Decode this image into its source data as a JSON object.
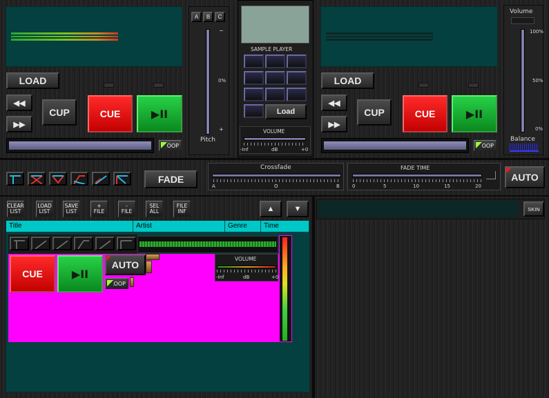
{
  "deck_left": {
    "load": "LOAD",
    "cup": "CUP",
    "cue": "CUE",
    "play": "▶II",
    "loop": "LOOP",
    "pitch": "Pitch",
    "pitch_pct": "0%",
    "pitch_plus": "+",
    "pitch_minus": "−",
    "abc": [
      "A",
      "B",
      "C"
    ]
  },
  "deck_right": {
    "load": "LOAD",
    "cup": "CUP",
    "cue": "CUE",
    "play": "▶II",
    "loop": "LOOP",
    "volume": "Volume",
    "balance": "Balance",
    "pct": [
      "100%",
      "50%",
      "0%"
    ]
  },
  "sampler": {
    "title": "SAMPLE PLAYER",
    "load": "Load",
    "volume": "VOLUME",
    "min": "-Inf",
    "db": "dB",
    "max": "+0"
  },
  "mixer": {
    "fade": "FADE",
    "crossfade": "Crossfade",
    "crossfade_ticks": [
      "A",
      "O",
      "B"
    ],
    "fadetime": "FADE TIME",
    "fadetime_ticks": [
      "0",
      "5",
      "10",
      "15",
      "20"
    ],
    "auto": "AUTO"
  },
  "playlist": {
    "buttons": [
      [
        "CLEAR",
        "LIST"
      ],
      [
        "LOAD",
        "LIST"
      ],
      [
        "SAVE",
        "LIST"
      ],
      [
        "+",
        "FILE"
      ],
      [
        "-",
        "FILE"
      ],
      [
        "SEL",
        "ALL"
      ],
      [
        "FILE",
        "INF"
      ]
    ],
    "columns": [
      "Title",
      "Artist",
      "Genre",
      "Time"
    ]
  },
  "mini": {
    "cue": "CUE",
    "play": "▶II",
    "auto": "AUTO",
    "loop": "LOOP",
    "volume": "VOLUME",
    "min": "-Inf",
    "db": "dB",
    "max": "+0"
  },
  "right_panel": {
    "skin": "SKIN"
  },
  "colors": {
    "cue": "#e01010",
    "play": "#18b030",
    "screen": "#04403f",
    "list_header": "#00c8c8",
    "magenta": "#ff00ff"
  }
}
